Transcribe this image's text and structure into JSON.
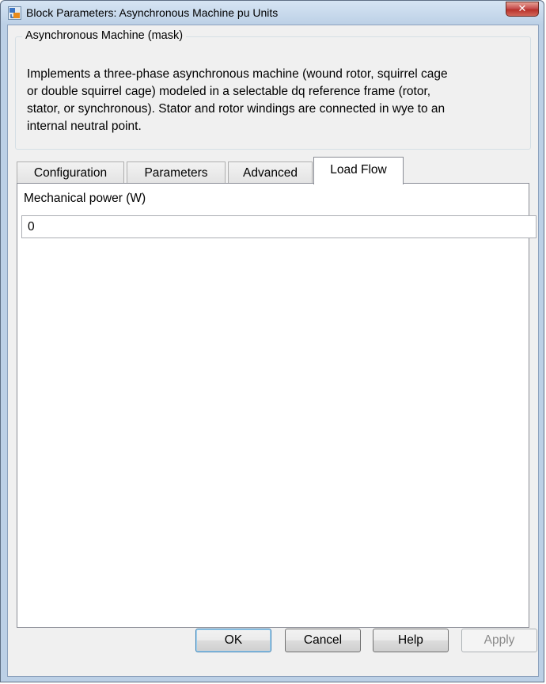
{
  "window": {
    "title": "Block Parameters: Asynchronous Machine pu Units",
    "close_glyph": "✕"
  },
  "mask": {
    "legend": "Asynchronous Machine (mask)",
    "description_lines": [
      "Implements a three-phase asynchronous machine (wound rotor, squirrel cage",
      "or double squirrel cage) modeled in a selectable dq reference frame (rotor,",
      "stator, or synchronous). Stator and rotor windings are connected in wye to an",
      "internal neutral point."
    ]
  },
  "tabs": [
    {
      "label": "Configuration"
    },
    {
      "label": "Parameters"
    },
    {
      "label": "Advanced"
    },
    {
      "label": "Load Flow"
    }
  ],
  "active_tab": "Load Flow",
  "load_flow": {
    "mechanical_power_label": "Mechanical power (W)",
    "mechanical_power_value": "0"
  },
  "buttons": {
    "ok": "OK",
    "cancel": "Cancel",
    "help": "Help",
    "apply": "Apply"
  },
  "icons": {
    "app": "simulink-block-icon",
    "close": "close-icon"
  },
  "colors": {
    "frame": "#bcd0e6",
    "close_button": "#c75050",
    "client_bg": "#f0f0f0"
  }
}
